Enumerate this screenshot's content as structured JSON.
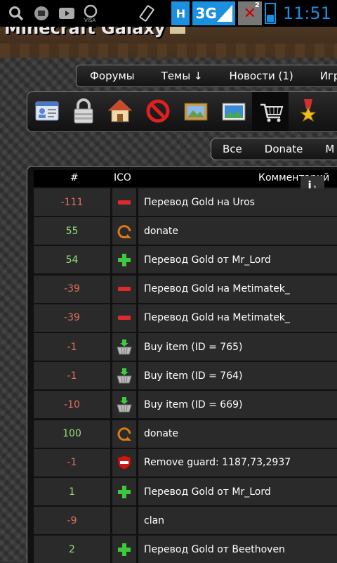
{
  "status_bar": {
    "network_h": "H",
    "network_3g": "3G",
    "sim2_label": "2",
    "time": "11:51",
    "icons": [
      "search-icon",
      "keyboard-icon",
      "youtube-icon",
      "visa-icon",
      "vibrate-icon",
      "signal-icon",
      "no-signal-icon",
      "battery-icon"
    ]
  },
  "header": {
    "site_title": "Minecraft Galaxy"
  },
  "nav": {
    "items": [
      "Форумы",
      "Темы ↓",
      "Новости (1)",
      "Игрок"
    ]
  },
  "toolbar": {
    "icons": [
      "profile-card-icon",
      "lock-icon",
      "home-icon",
      "ban-icon",
      "picture-icon",
      "landscape-icon",
      "shopping-cart-icon",
      "medal-icon"
    ],
    "active": "shopping-cart-icon"
  },
  "filters": {
    "items": [
      "Все",
      "Donate",
      "М"
    ]
  },
  "table": {
    "headers": {
      "num": "#",
      "ico": "ICO",
      "comment": "Комментарий"
    },
    "info_badge": "1",
    "rows": [
      {
        "num": "-111",
        "sign": "neg",
        "icon": "minus-icon",
        "comment": "Перевод Gold на Uros"
      },
      {
        "num": "55",
        "sign": "pos",
        "icon": "donate-ring-icon",
        "comment": "donate"
      },
      {
        "num": "54",
        "sign": "pos",
        "icon": "plus-icon",
        "comment": "Перевод Gold от Mr_Lord"
      },
      {
        "num": "-39",
        "sign": "neg",
        "icon": "minus-icon",
        "comment": "Перевод Gold на Metimatek_"
      },
      {
        "num": "-39",
        "sign": "neg",
        "icon": "minus-icon",
        "comment": "Перевод Gold на Metimatek_"
      },
      {
        "num": "-1",
        "sign": "neg",
        "icon": "basket-icon",
        "comment": "Buy item (ID = 765)"
      },
      {
        "num": "-1",
        "sign": "neg",
        "icon": "basket-icon",
        "comment": "Buy item (ID = 764)"
      },
      {
        "num": "-10",
        "sign": "neg",
        "icon": "basket-icon",
        "comment": "Buy item (ID = 669)"
      },
      {
        "num": "100",
        "sign": "pos",
        "icon": "donate-ring-icon",
        "comment": "donate"
      },
      {
        "num": "-1",
        "sign": "neg",
        "icon": "guard-icon",
        "comment": "Remove guard: 1187,73,2937"
      },
      {
        "num": "1",
        "sign": "pos",
        "icon": "plus-icon",
        "comment": "Перевод Gold от Mr_Lord"
      },
      {
        "num": "-9",
        "sign": "neg",
        "icon": "",
        "comment": "clan"
      },
      {
        "num": "2",
        "sign": "pos",
        "icon": "plus-icon",
        "comment": "Перевод Gold от Beethoven"
      }
    ]
  }
}
